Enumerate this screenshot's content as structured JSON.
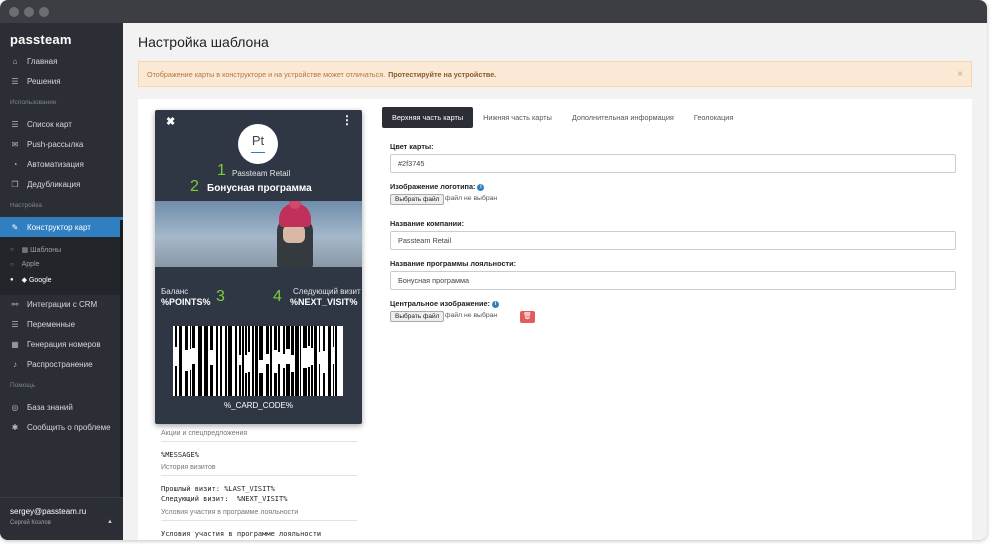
{
  "sidebar": {
    "logo": "passteam",
    "items": [
      {
        "label": "Главная",
        "icon": "home-icon",
        "glyph": "⌂"
      },
      {
        "label": "Решения",
        "icon": "list-icon",
        "glyph": "☰"
      },
      {
        "label": "Список карт",
        "icon": "list-icon",
        "glyph": "☰"
      },
      {
        "label": "Push-рассылка",
        "icon": "megaphone-icon",
        "glyph": "✉"
      },
      {
        "label": "Автоматизация",
        "icon": "gauge-icon",
        "glyph": "◔"
      },
      {
        "label": "Дедубликация",
        "icon": "copy-icon",
        "glyph": "❐"
      },
      {
        "label": "Конструктор карт",
        "icon": "brush-icon",
        "glyph": "✎"
      },
      {
        "label": "Интеграции с CRM",
        "icon": "sitemap-icon",
        "glyph": "⚯"
      },
      {
        "label": "Переменные",
        "icon": "list-icon",
        "glyph": "☰"
      },
      {
        "label": "Генерация номеров",
        "icon": "grid-icon",
        "glyph": "▦"
      },
      {
        "label": "Распространение",
        "icon": "bell-icon",
        "glyph": "♪"
      },
      {
        "label": "База знаний",
        "icon": "lifebuoy-icon",
        "glyph": "◎"
      },
      {
        "label": "Сообщить о проблеме",
        "icon": "bug-icon",
        "glyph": "✱"
      }
    ],
    "sections": {
      "usage": "Использование",
      "settings": "Настройка",
      "help": "Помощь"
    },
    "sub_items": [
      {
        "label": "▦ Шаблоны"
      },
      {
        "label": " Apple"
      },
      {
        "label": "◆ Google"
      }
    ],
    "user_email": "sergey@passteam.ru",
    "user_name": "Сергей Козлов"
  },
  "page": {
    "title": "Настройка шаблона",
    "alert_text": "Отображение карты в конструкторе и на устройстве может отличаться.",
    "alert_bold": "Протестируйте на устройстве."
  },
  "card": {
    "logo_text": "Pt",
    "company": "Passteam Retail",
    "program": "Бонусная программа",
    "ann1": "1",
    "ann2": "2",
    "ann3": "3",
    "ann4": "4",
    "balance_label": "Баланс",
    "balance_value": "%POINTS%",
    "visit_label": "Следующий визит",
    "visit_value": "%NEXT_VISIT%",
    "code": "%_CARD_CODE%",
    "background_color": "#2f3745"
  },
  "back": {
    "offers_title": "Акции и спецпредложения",
    "offers_body": "%MESSAGE%",
    "history_title": "История визитов",
    "history_body": "Прошлый визит: %LAST_VISIT%\nСледующий визит:  %NEXT_VISIT%",
    "terms_title": "Условия участия в программе лояльности",
    "terms_body": "Условия участия в программе лояльности"
  },
  "tabs": [
    {
      "label": "Верхняя часть карты"
    },
    {
      "label": "Нижняя часть карты"
    },
    {
      "label": "Дополнительная информация"
    },
    {
      "label": "Геолокация"
    }
  ],
  "form": {
    "color_label": "Цвет карты:",
    "color_value": "#2f3745",
    "logo_label": "Изображение логотипа:",
    "file_button": "Выбрать файл",
    "file_none": "файл не выбран",
    "company_label": "Название компании:",
    "company_value": "Passteam Retail",
    "program_label": "Название программы лояльности:",
    "program_value": "Бонусная программа",
    "center_image_label": "Центральное изображение:"
  }
}
